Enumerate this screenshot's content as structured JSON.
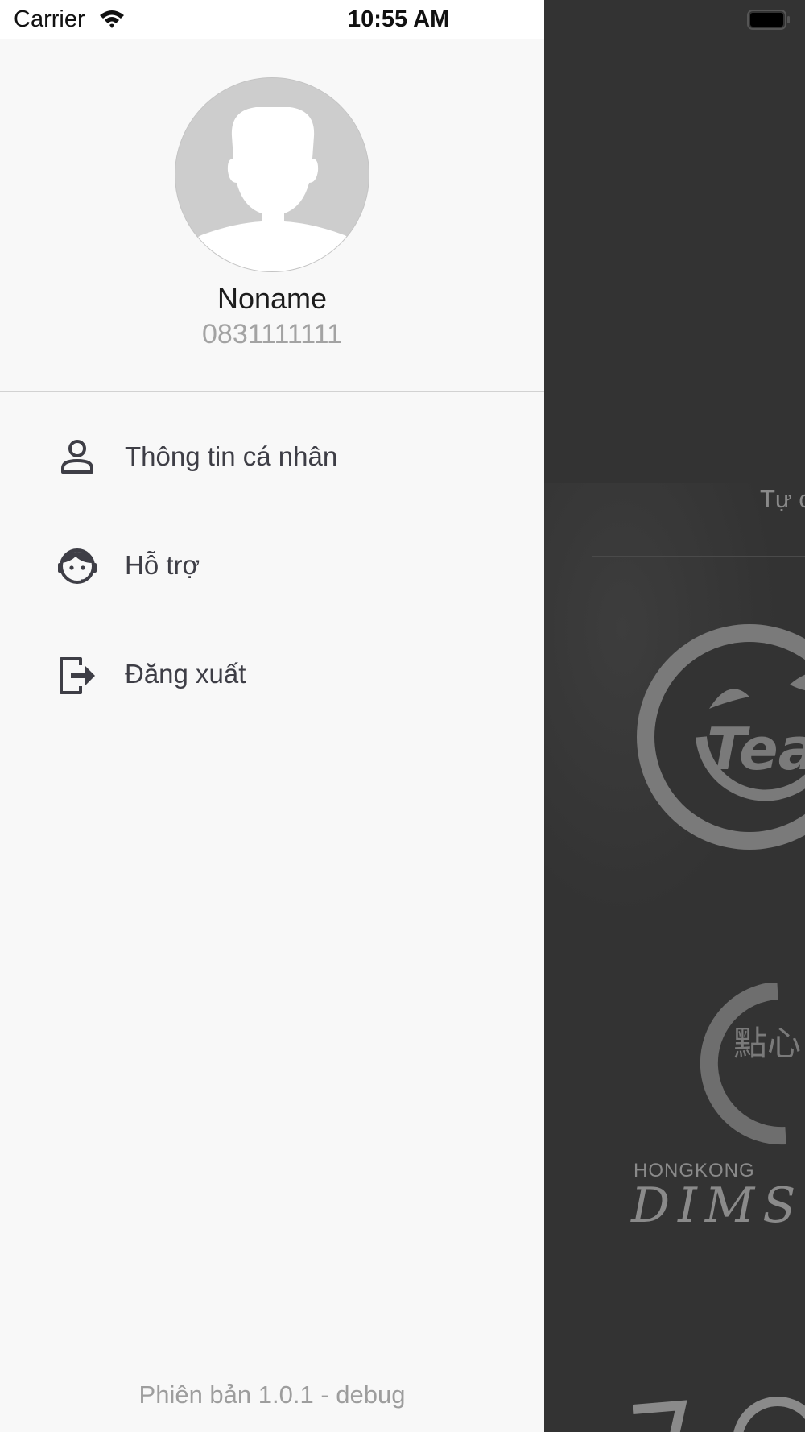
{
  "status_bar": {
    "carrier": "Carrier",
    "time": "10:55 AM"
  },
  "user": {
    "name": "Noname",
    "phone": "0831111111"
  },
  "menu": {
    "items": [
      {
        "label": "Thông tin cá nhân",
        "icon": "person-icon"
      },
      {
        "label": "Hỗ trợ",
        "icon": "support-agent-icon"
      },
      {
        "label": "Đăng xuất",
        "icon": "logout-icon"
      }
    ]
  },
  "footer": {
    "version": "Phiên bản 1.0.1 - debug"
  },
  "background_app": {
    "partial_text": "Tự c",
    "logo_tea_text": "Tea",
    "logo_hk_text": "HONGKONG",
    "logo_dims_text": "DIMS",
    "logo_chinese": "點心"
  },
  "colors": {
    "drawer_bg": "#f8f8f8",
    "icon_color": "#3e3e46",
    "overlay_bg": "#333333",
    "muted_text": "#9d9d9d"
  }
}
